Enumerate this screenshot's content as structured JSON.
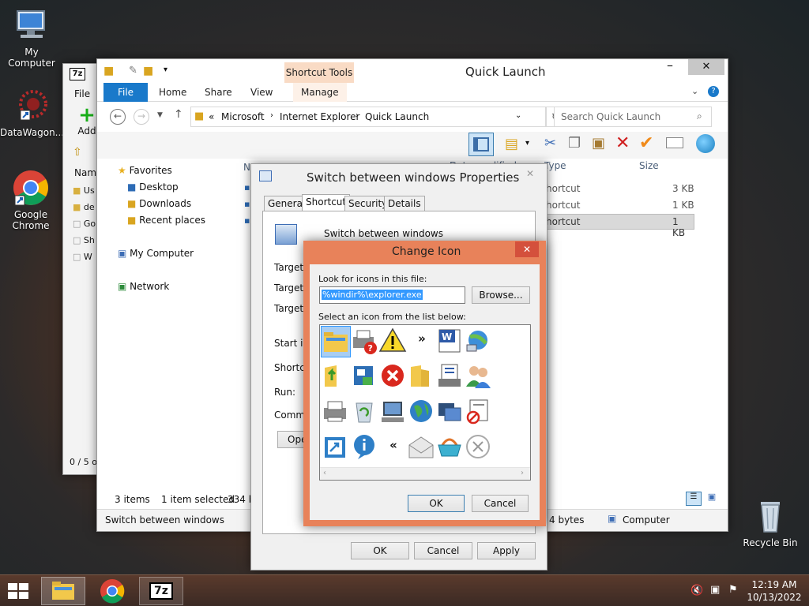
{
  "desktop": {
    "icons": [
      {
        "label": "My Computer"
      },
      {
        "label": "DataWagon..."
      },
      {
        "label": "Google Chrome"
      },
      {
        "label": "Recycle Bin"
      }
    ]
  },
  "sevenzip_window": {
    "title_logo": "7z",
    "menu_file": "File",
    "add_label": "Add",
    "col_name": "Name",
    "rows": [
      "Us",
      "de",
      "Go",
      "Sh",
      "W"
    ],
    "status": "0 / 5 o"
  },
  "explorer": {
    "title": "Quick Launch",
    "context_tab": "Shortcut Tools",
    "tabs": [
      "File",
      "Home",
      "Share",
      "View",
      "Manage"
    ],
    "breadcrumb_prefix": "«",
    "breadcrumb": [
      "Microsoft",
      "Internet Explorer",
      "Quick Launch"
    ],
    "search_placeholder": "Search Quick Launch",
    "nav": {
      "favorites": "Favorites",
      "desktop": "Desktop",
      "downloads": "Downloads",
      "recent": "Recent places",
      "computer": "My Computer",
      "network": "Network"
    },
    "columns": {
      "name": "Name",
      "date": "Date modified",
      "type": "Type",
      "size": "Size"
    },
    "files": [
      {
        "type": "hortcut",
        "size": "3 KB"
      },
      {
        "type": "hortcut",
        "size": "1 KB"
      },
      {
        "type": "hortcut",
        "size": "1 KB"
      }
    ],
    "status_items": "3 items",
    "status_selected": "1 item selected",
    "status_size": "334 by",
    "details_name": "Switch between windows",
    "details_size": "4 bytes",
    "details_location": "Computer"
  },
  "properties": {
    "title": "Switch between windows Properties",
    "tabs": [
      "General",
      "Shortcut",
      "Security",
      "Details"
    ],
    "shortcut_name": "Switch between windows",
    "labels": [
      "Target ty",
      "Target lo",
      "Target:",
      "Start in:",
      "Shortcut",
      "Run:",
      "Commen"
    ],
    "open_btn": "Open",
    "ok": "OK",
    "cancel": "Cancel",
    "apply": "Apply"
  },
  "change_icon": {
    "title": "Change Icon",
    "look_label": "Look for icons in this file:",
    "file_value": "%windir%\\explorer.exe",
    "browse": "Browse...",
    "select_label": "Select an icon from the list below:",
    "ok": "OK",
    "cancel": "Cancel",
    "accent": "#e8825a"
  },
  "taskbar": {
    "time": "12:19 AM",
    "date": "10/13/2022",
    "sevenzip": "7z"
  }
}
